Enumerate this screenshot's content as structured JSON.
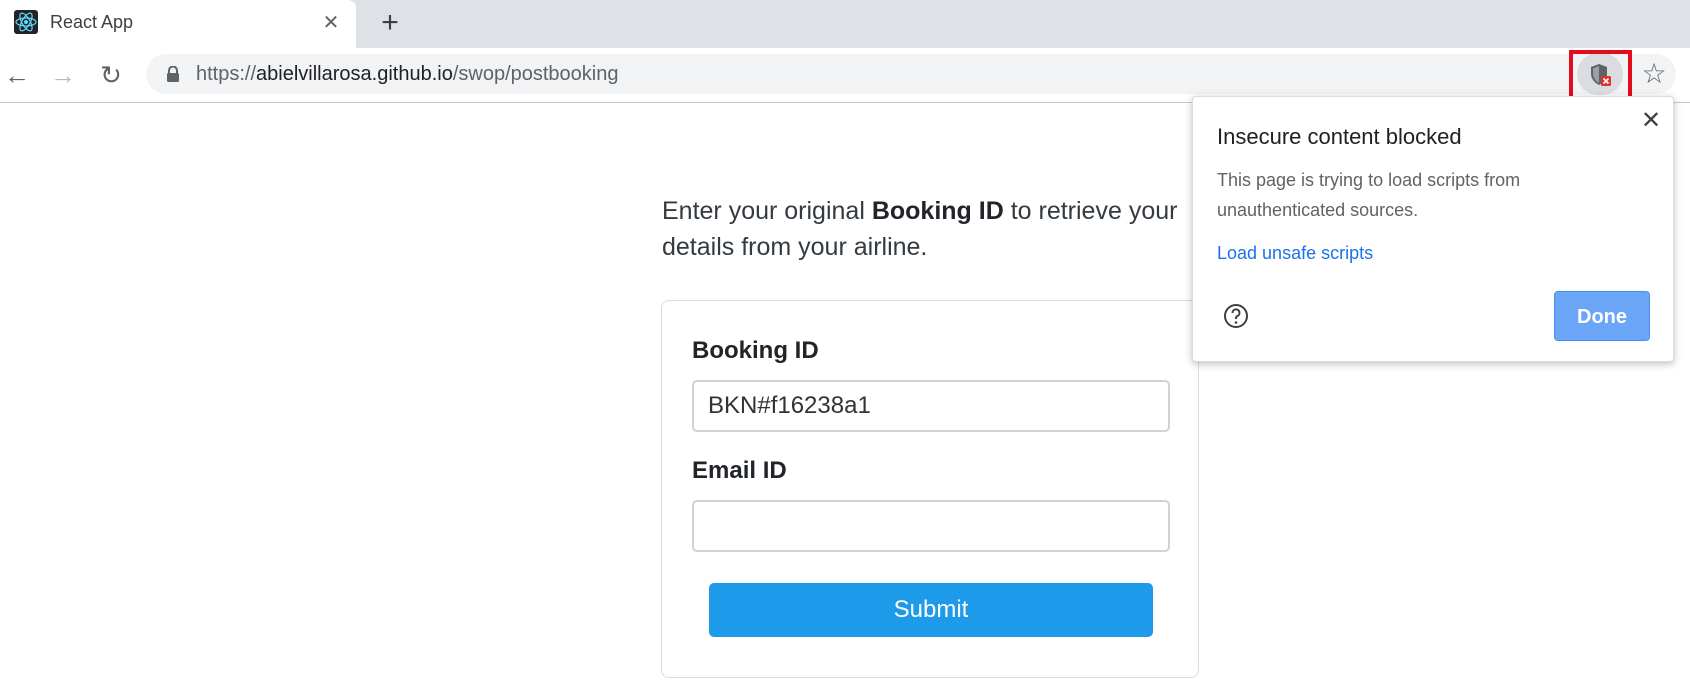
{
  "browser": {
    "tab_title": "React App",
    "tab_close": "✕",
    "new_tab": "+",
    "url_scheme": "https://",
    "url_host": "abielvillarosa.github.io",
    "url_path": "/swop/postbooking"
  },
  "page": {
    "intro_prefix": "Enter your original ",
    "intro_bold": "Booking ID",
    "intro_suffix": " to retrieve your details from your airline.",
    "form": {
      "booking_label": "Booking ID",
      "booking_value": "BKN#f16238a1",
      "email_label": "Email ID",
      "email_value": "",
      "submit_label": "Submit"
    }
  },
  "popup": {
    "title": "Insecure content blocked",
    "text": "This page is trying to load scripts from unauthenticated sources.",
    "link": "Load unsafe scripts",
    "done_label": "Done",
    "close": "✕"
  },
  "colors": {
    "highlight": "#e30b1d",
    "submit": "#1e9aea",
    "done": "#6aa5f7",
    "link": "#1a73e8"
  }
}
